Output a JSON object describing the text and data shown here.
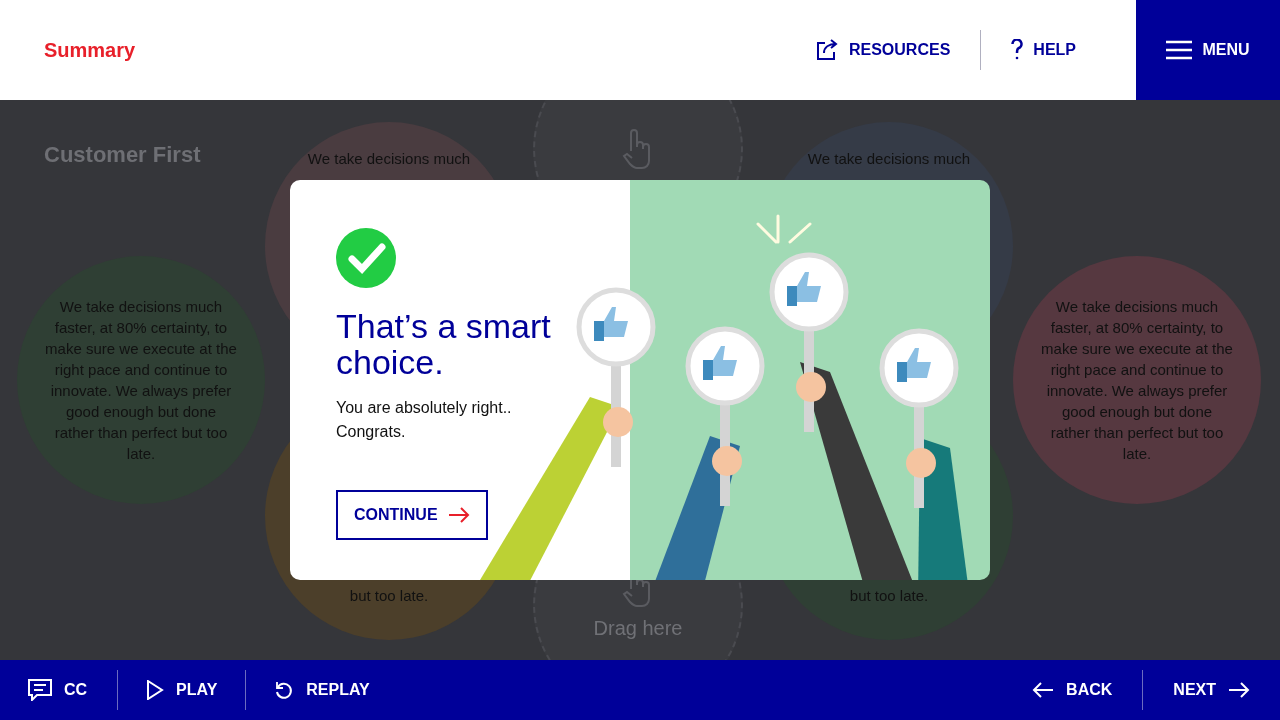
{
  "header": {
    "title": "Summary",
    "links": [
      {
        "kind": "resources",
        "label": "RESOURCES"
      },
      {
        "kind": "help",
        "label": "HELP"
      }
    ],
    "menu": "MENU"
  },
  "activity": {
    "heading": "Customer First",
    "circles": [
      {
        "text": "We take decisions much faster, at 80% certainty, to make sure we execute at the right pace and continue to innovate. We always prefer good enough but done rather than perfect but too late.",
        "color": "#2f3f34"
      },
      {
        "text": "We take decisions much",
        "color": "#4a3c40"
      },
      {
        "text": "but too late.",
        "color": "#4c3f2a"
      },
      {
        "text": "We take decisions much",
        "color": "#353b47"
      },
      {
        "text": "but too late.",
        "color": "#2f3f34"
      },
      {
        "text": "We take decisions much faster, at 80% certainty, to make sure we execute at the right pace and continue to innovate. We always prefer good enough but done rather than perfect but too late.",
        "color": "#563840"
      }
    ],
    "drop_zones": [
      {
        "kind": "top"
      },
      {
        "kind": "bottom",
        "label": "Drag here"
      }
    ]
  },
  "dialog": {
    "title": "That’s a smart choice.",
    "message": "You are absolutely right.. Congrats.",
    "button": "CONTINUE"
  },
  "footer": {
    "left": [
      {
        "kind": "cc",
        "label": "CC"
      },
      {
        "kind": "play",
        "label": "PLAY"
      },
      {
        "kind": "replay",
        "label": "REPLAY"
      }
    ],
    "right": [
      {
        "kind": "back",
        "label": "BACK"
      },
      {
        "kind": "next",
        "label": "NEXT"
      }
    ]
  }
}
